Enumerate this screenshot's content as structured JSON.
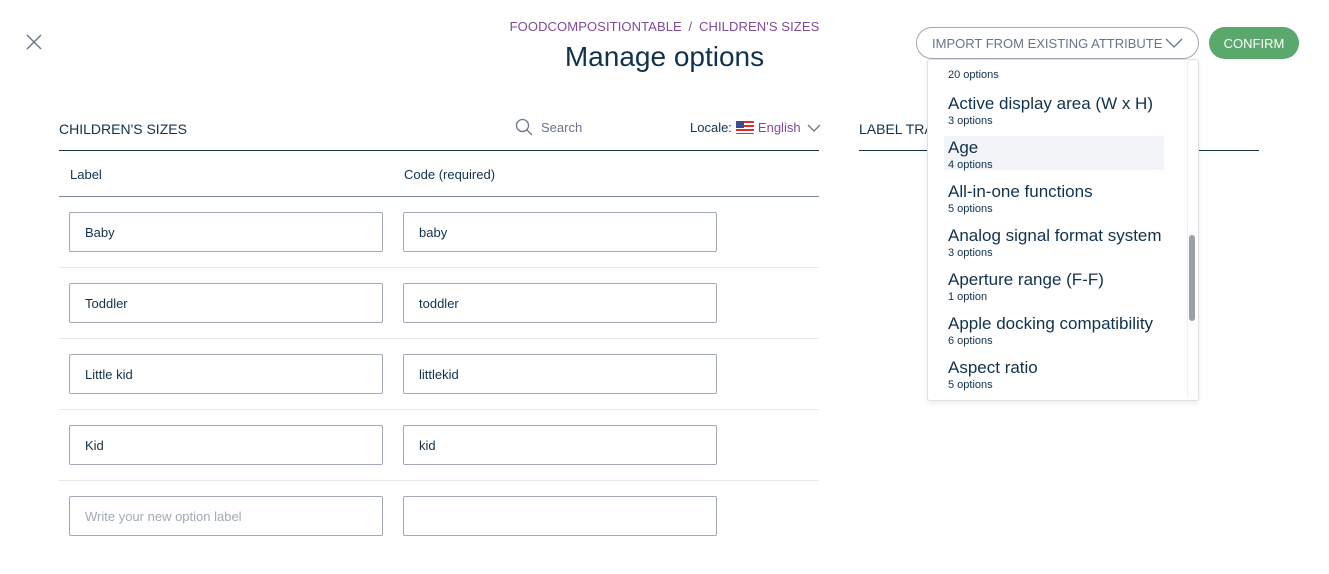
{
  "header": {
    "breadcrumb_parent": "FOODCOMPOSITIONTABLE",
    "breadcrumb_separator": "/",
    "breadcrumb_current": "CHILDREN'S SIZES",
    "title": "Manage options",
    "import_label": "IMPORT FROM EXISTING ATTRIBUTE",
    "confirm_label": "CONFIRM"
  },
  "options_panel": {
    "section_title": "CHILDREN'S SIZES",
    "search_placeholder": "Search",
    "locale_label": "Locale:",
    "locale_value": "English",
    "col_label": "Label",
    "col_code": "Code (required)",
    "rows": [
      {
        "label": "Baby",
        "code": "baby"
      },
      {
        "label": "Toddler",
        "code": "toddler"
      },
      {
        "label": "Little kid",
        "code": "littlekid"
      },
      {
        "label": "Kid",
        "code": "kid"
      }
    ],
    "new_row": {
      "label_placeholder": "Write your new option label",
      "code_value": ""
    }
  },
  "translations_panel": {
    "title": "LABEL TRANSLATIONS"
  },
  "import_dropdown": {
    "top_partial_count": "20 options",
    "items": [
      {
        "name": "Active display area (W x H)",
        "count": "3 options",
        "highlighted": false
      },
      {
        "name": "Age",
        "count": "4 options",
        "highlighted": true
      },
      {
        "name": "All-in-one functions",
        "count": "5 options",
        "highlighted": false
      },
      {
        "name": "Analog signal format system",
        "count": "3 options",
        "highlighted": false
      },
      {
        "name": "Aperture range (F-F)",
        "count": "1 option",
        "highlighted": false
      },
      {
        "name": "Apple docking compatibility",
        "count": "6 options",
        "highlighted": false
      },
      {
        "name": "Aspect ratio",
        "count": "5 options",
        "highlighted": false
      }
    ]
  },
  "icons": {
    "close": "close-icon",
    "search": "search-icon",
    "flag": "us-flag-icon",
    "chevron": "chevron-down-icon"
  },
  "colors": {
    "primary_text": "#11324d",
    "accent_purple": "#7f4b9a",
    "confirm_green": "#5aa86b",
    "muted": "#67768a",
    "border": "#a1a9b7",
    "highlight": "#f2f4f8"
  }
}
